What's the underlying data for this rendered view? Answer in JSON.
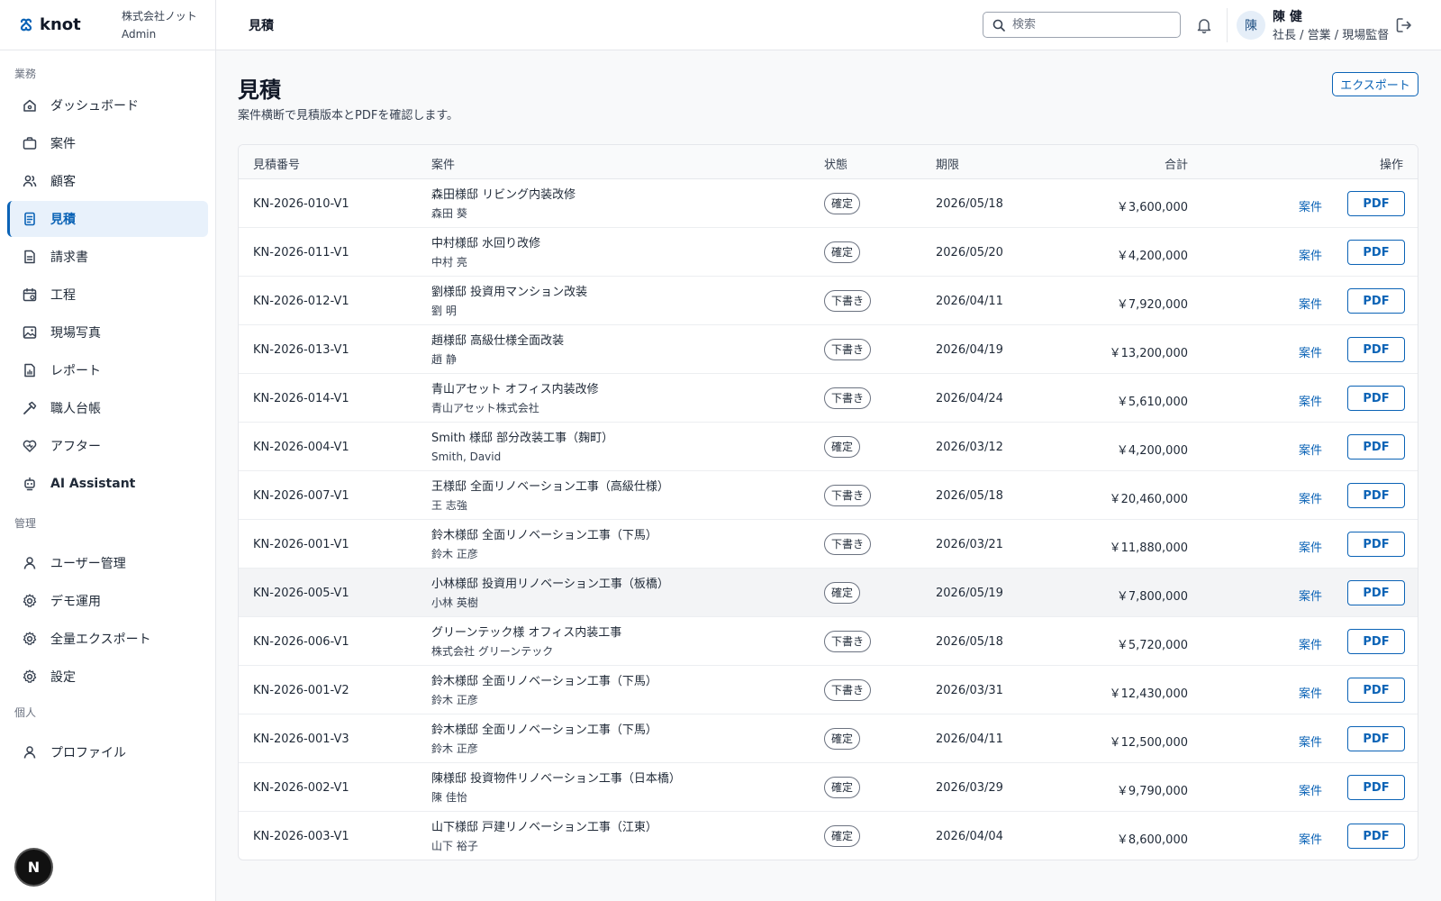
{
  "brand": {
    "name": "knot",
    "org": "株式会社ノット",
    "role": "Admin"
  },
  "sidebar": {
    "sections": [
      {
        "label": "業務",
        "items": [
          {
            "label": "ダッシュボード",
            "icon": "home-icon"
          },
          {
            "label": "案件",
            "icon": "briefcase-icon"
          },
          {
            "label": "顧客",
            "icon": "users-icon"
          },
          {
            "label": "見積",
            "icon": "document-icon",
            "active": true
          },
          {
            "label": "請求書",
            "icon": "invoice-icon"
          },
          {
            "label": "工程",
            "icon": "calendar-icon"
          },
          {
            "label": "現場写真",
            "icon": "image-icon"
          },
          {
            "label": "レポート",
            "icon": "report-icon"
          },
          {
            "label": "職人台帳",
            "icon": "hammer-icon"
          },
          {
            "label": "アフター",
            "icon": "heart-icon"
          },
          {
            "label": "AI Assistant",
            "icon": "robot-icon"
          }
        ]
      },
      {
        "label": "管理",
        "items": [
          {
            "label": "ユーザー管理",
            "icon": "user-icon"
          },
          {
            "label": "デモ運用",
            "icon": "gear-icon"
          },
          {
            "label": "全量エクスポート",
            "icon": "gear-icon"
          },
          {
            "label": "設定",
            "icon": "gear-icon"
          }
        ]
      },
      {
        "label": "個人",
        "items": [
          {
            "label": "プロファイル",
            "icon": "user-icon"
          }
        ]
      }
    ],
    "badge": "N"
  },
  "topbar": {
    "breadcrumb": "見積",
    "search_placeholder": "検索",
    "user": {
      "avatar": "陳",
      "name": "陳 健",
      "role": "社長 / 営業 / 現場監督"
    }
  },
  "page": {
    "title": "見積",
    "subtitle": "案件横断で見積版本とPDFを確認します。",
    "export_label": "エクスポート"
  },
  "table": {
    "columns": [
      "見積番号",
      "案件",
      "状態",
      "期限",
      "合計",
      "操作"
    ],
    "link_label": "案件",
    "pdf_label": "PDF",
    "rows": [
      {
        "no": "KN-2026-010-V1",
        "project": "森田様邸 リビング内装改修",
        "customer": "森田 葵",
        "status": "確定",
        "due": "2026/05/18",
        "total": "￥3,600,000"
      },
      {
        "no": "KN-2026-011-V1",
        "project": "中村様邸 水回り改修",
        "customer": "中村 亮",
        "status": "確定",
        "due": "2026/05/20",
        "total": "￥4,200,000"
      },
      {
        "no": "KN-2026-012-V1",
        "project": "劉様邸 投資用マンション改装",
        "customer": "劉 明",
        "status": "下書き",
        "due": "2026/04/11",
        "total": "￥7,920,000"
      },
      {
        "no": "KN-2026-013-V1",
        "project": "趙様邸 高級仕様全面改装",
        "customer": "趙 静",
        "status": "下書き",
        "due": "2026/04/19",
        "total": "￥13,200,000"
      },
      {
        "no": "KN-2026-014-V1",
        "project": "青山アセット オフィス内装改修",
        "customer": "青山アセット株式会社",
        "status": "下書き",
        "due": "2026/04/24",
        "total": "￥5,610,000"
      },
      {
        "no": "KN-2026-004-V1",
        "project": "Smith 様邸 部分改装工事（麹町）",
        "customer": "Smith, David",
        "status": "確定",
        "due": "2026/03/12",
        "total": "￥4,200,000"
      },
      {
        "no": "KN-2026-007-V1",
        "project": "王様邸 全面リノベーション工事（高級仕様）",
        "customer": "王 志強",
        "status": "下書き",
        "due": "2026/05/18",
        "total": "￥20,460,000"
      },
      {
        "no": "KN-2026-001-V1",
        "project": "鈴木様邸 全面リノベーション工事（下馬）",
        "customer": "鈴木 正彦",
        "status": "下書き",
        "due": "2026/03/21",
        "total": "￥11,880,000"
      },
      {
        "no": "KN-2026-005-V1",
        "project": "小林様邸 投資用リノベーション工事（板橋）",
        "customer": "小林 英樹",
        "status": "確定",
        "due": "2026/05/19",
        "total": "￥7,800,000",
        "hover": true
      },
      {
        "no": "KN-2026-006-V1",
        "project": "グリーンテック様 オフィス内装工事",
        "customer": "株式会社 グリーンテック",
        "status": "下書き",
        "due": "2026/05/18",
        "total": "￥5,720,000"
      },
      {
        "no": "KN-2026-001-V2",
        "project": "鈴木様邸 全面リノベーション工事（下馬）",
        "customer": "鈴木 正彦",
        "status": "下書き",
        "due": "2026/03/31",
        "total": "￥12,430,000"
      },
      {
        "no": "KN-2026-001-V3",
        "project": "鈴木様邸 全面リノベーション工事（下馬）",
        "customer": "鈴木 正彦",
        "status": "確定",
        "due": "2026/04/11",
        "total": "￥12,500,000"
      },
      {
        "no": "KN-2026-002-V1",
        "project": "陳様邸 投資物件リノベーション工事（日本橋）",
        "customer": "陳 佳怡",
        "status": "確定",
        "due": "2026/03/29",
        "total": "￥9,790,000"
      },
      {
        "no": "KN-2026-003-V1",
        "project": "山下様邸 戸建リノベーション工事（江東）",
        "customer": "山下 裕子",
        "status": "確定",
        "due": "2026/04/04",
        "total": "￥8,600,000"
      }
    ]
  }
}
